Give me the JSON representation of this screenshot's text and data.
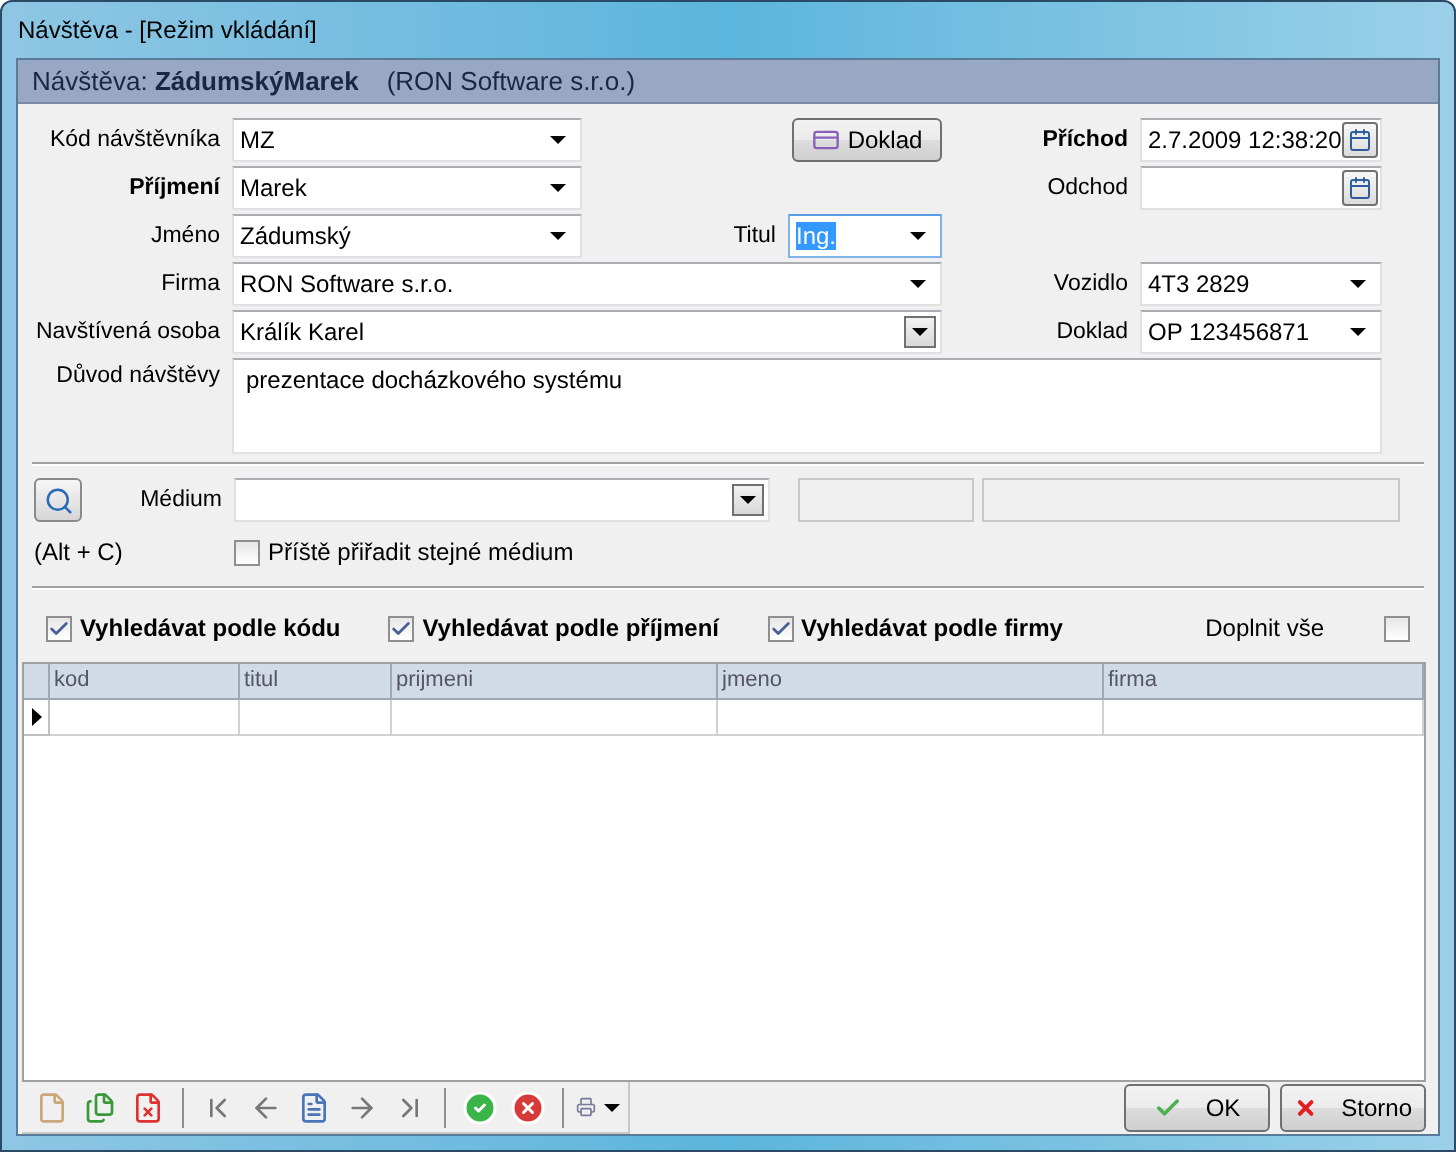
{
  "window": {
    "title": "Návštěva - [Režim vkládání]"
  },
  "header": {
    "label": "Návštěva:",
    "name": "ZádumskýMarek",
    "company": "(RON Software s.r.o.)"
  },
  "rows": [
    {
      "left": {
        "label": "Kód návštěvníka",
        "bold": false,
        "kind": "combo",
        "value": "MZ"
      },
      "middle": {
        "kind": "button",
        "label": "Doklad"
      },
      "right": {
        "label": "Příchod",
        "bold": true,
        "kind": "date",
        "value": "2.7.2009 12:38:20"
      }
    },
    {
      "left": {
        "label": "Příjmení",
        "bold": true,
        "kind": "combo",
        "value": "Marek"
      },
      "right": {
        "label": "Odchod",
        "bold": false,
        "kind": "date"
      }
    },
    {
      "left": {
        "label": "Jméno",
        "bold": false,
        "kind": "combo",
        "value": "Zádumský"
      },
      "middle": {
        "kind": "field",
        "label": "Titul",
        "value": "Ing.",
        "text_selected": true
      }
    },
    {
      "left": {
        "label": "Firma",
        "bold": false,
        "kind": "combo-wide",
        "value": "RON Software s.r.o."
      },
      "right": {
        "label": "Vozidlo",
        "bold": false,
        "kind": "combo",
        "value": "4T3 2829"
      }
    },
    {
      "left": {
        "label": "Navštívená osoba",
        "bold": false,
        "kind": "lookup",
        "value": "Králík Karel"
      },
      "right": {
        "label": "Doklad",
        "bold": false,
        "kind": "combo",
        "value": "OP 123456871"
      }
    }
  ],
  "reason": {
    "label": "Důvod návštěvy",
    "value": "prezentace docházkového systému"
  },
  "medium": {
    "label": "Médium",
    "shortcut": "(Alt + C)",
    "same_medium": {
      "label": "Příště přiřadit stejné médium",
      "checked": false
    }
  },
  "search_options": [
    {
      "label": "Vyhledávat podle kódu",
      "checked": true
    },
    {
      "label": "Vyhledávat podle příjmení",
      "checked": true
    },
    {
      "label": "Vyhledávat podle firmy",
      "checked": true
    }
  ],
  "fill_all": {
    "label": "Doplnit vše",
    "checked": false
  },
  "table": {
    "columns": [
      "kod",
      "titul",
      "prijmeni",
      "jmeno",
      "firma"
    ]
  },
  "toolbar": [
    {
      "kind": "new"
    },
    {
      "kind": "copy"
    },
    {
      "kind": "delete"
    },
    {
      "kind": "separator"
    },
    {
      "kind": "first"
    },
    {
      "kind": "prev"
    },
    {
      "kind": "detail"
    },
    {
      "kind": "next"
    },
    {
      "kind": "last"
    },
    {
      "kind": "separator"
    },
    {
      "kind": "confirm"
    },
    {
      "kind": "cancel"
    },
    {
      "kind": "separator"
    },
    {
      "kind": "print"
    }
  ],
  "buttons": [
    {
      "kind": "ok",
      "label": "OK"
    },
    {
      "kind": "cancel",
      "label": "Storno"
    }
  ]
}
